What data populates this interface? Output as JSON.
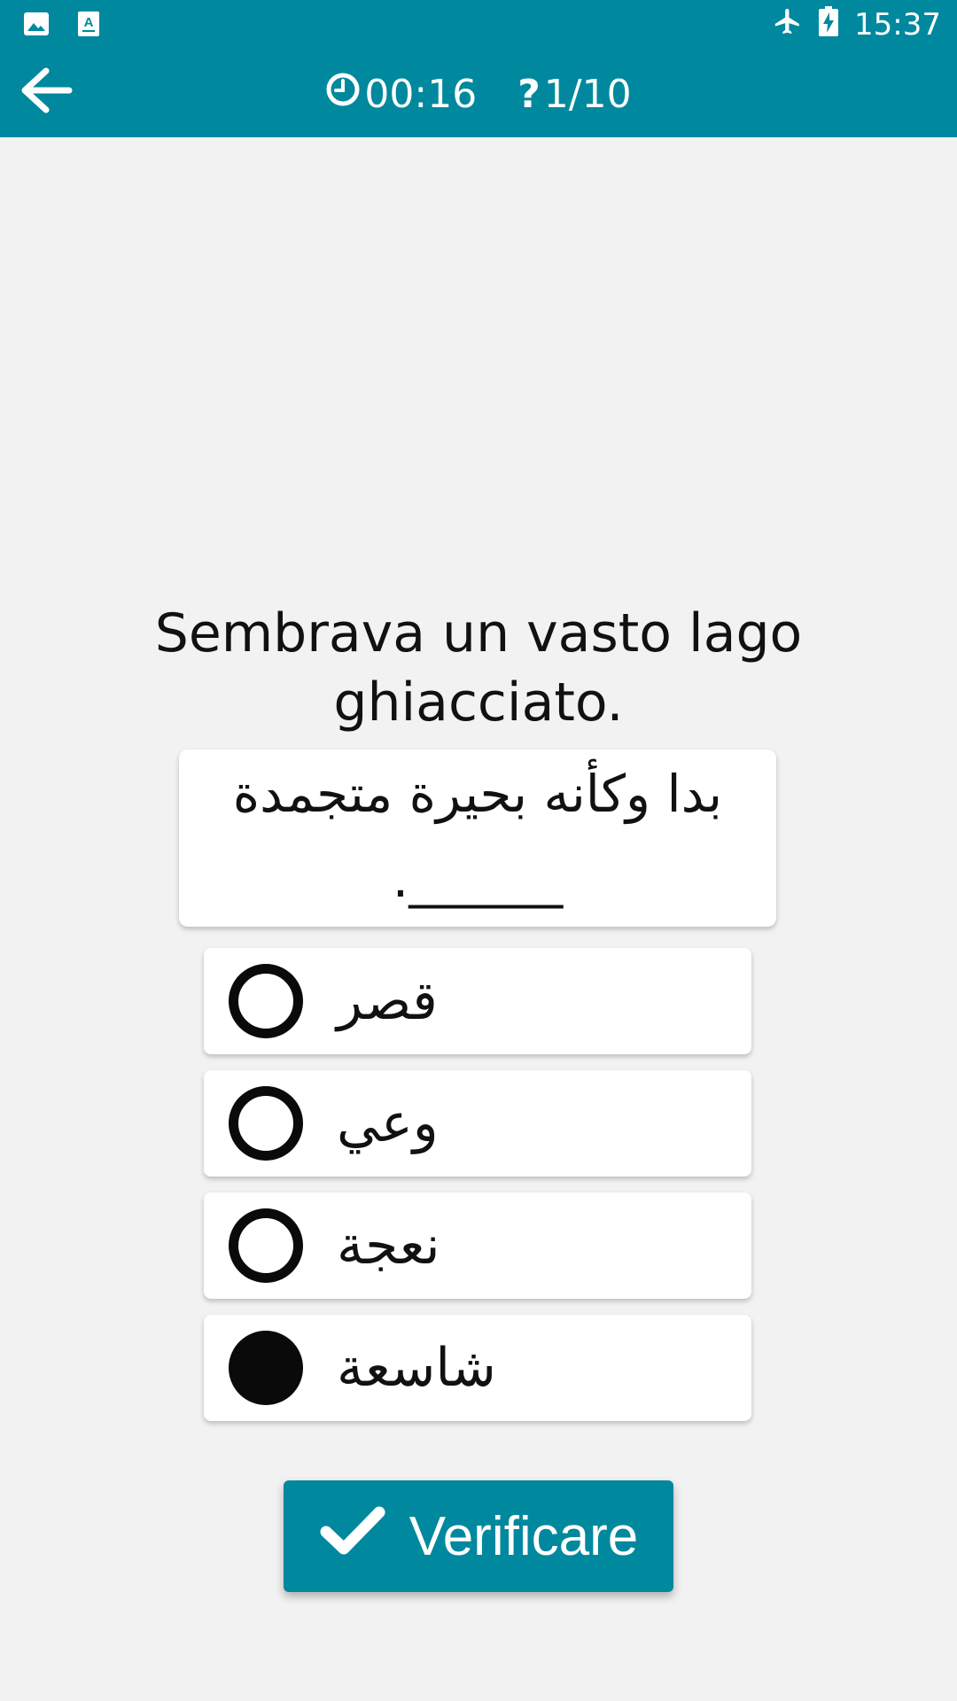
{
  "status_bar": {
    "time": "15:37",
    "left_icons": [
      "image-icon",
      "font-icon"
    ],
    "right_icons": [
      "airplane-icon",
      "battery-charging-icon"
    ]
  },
  "header": {
    "back_icon": "arrow-back-icon",
    "timer": "00:16",
    "timer_icon": "clock-icon",
    "progress": "1/10",
    "progress_icon": "question-mark-icon"
  },
  "question": {
    "text": "Sembrava un vasto lago ghiacciato.",
    "sentence": "بدا وكأنه بحيرة متجمدة ______."
  },
  "options": [
    {
      "label": "قصر",
      "selected": false
    },
    {
      "label": "وعي",
      "selected": false
    },
    {
      "label": "نعجة",
      "selected": false
    },
    {
      "label": "شاسعة",
      "selected": true
    }
  ],
  "verify_button": {
    "label": "Verificare",
    "icon": "check-icon"
  },
  "colors": {
    "primary": "#00889e",
    "background": "#f2f2f2"
  }
}
